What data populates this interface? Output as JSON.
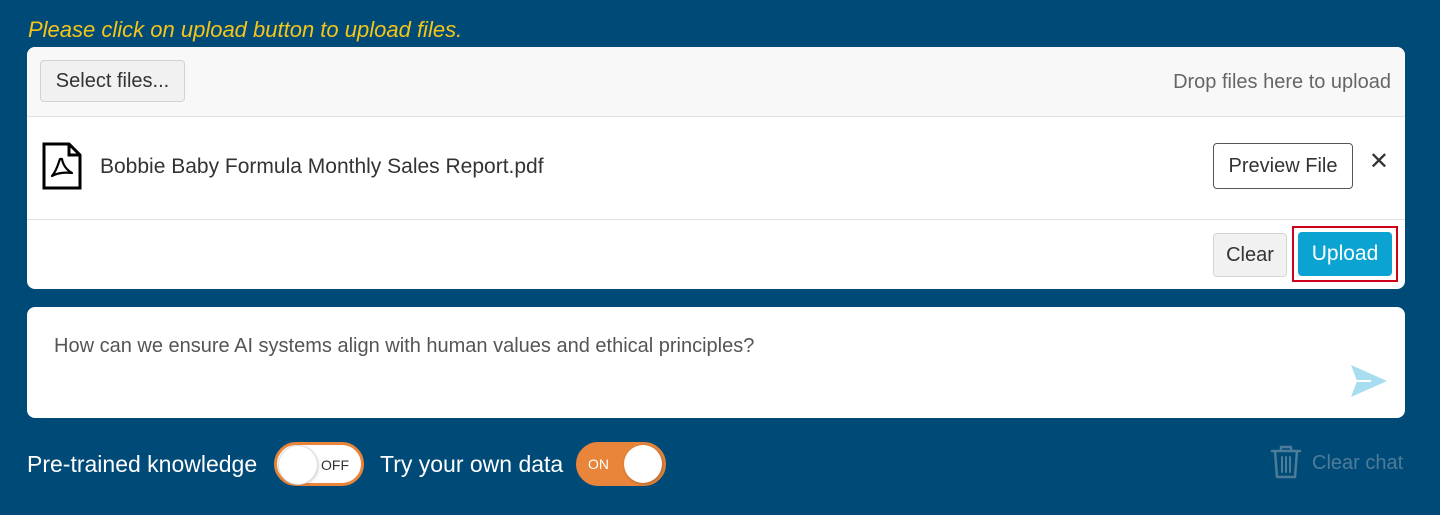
{
  "hint_text": "Please click on upload button to upload files.",
  "uploader": {
    "select_label": "Select files...",
    "drop_hint": "Drop files here to upload",
    "file": {
      "name": "Bobbie Baby Formula Monthly Sales Report.pdf",
      "icon": "pdf-file-icon",
      "preview_label": "Preview File",
      "remove_label": "✕"
    },
    "clear_label": "Clear",
    "upload_label": "Upload"
  },
  "chat": {
    "question": "How can we ensure AI systems align with human values and ethical principles?",
    "send_icon": "send-icon"
  },
  "options": {
    "pretrained_label": "Pre-trained knowledge",
    "pretrained_state": "OFF",
    "owndata_label": "Try your own data",
    "owndata_state": "ON",
    "clear_chat_label": "Clear chat"
  },
  "colors": {
    "background": "#004a77",
    "hint": "#f5c518",
    "upload_button": "#0ba3d1",
    "toggle_accent": "#e8853a",
    "highlight_outline": "#d0021b"
  }
}
